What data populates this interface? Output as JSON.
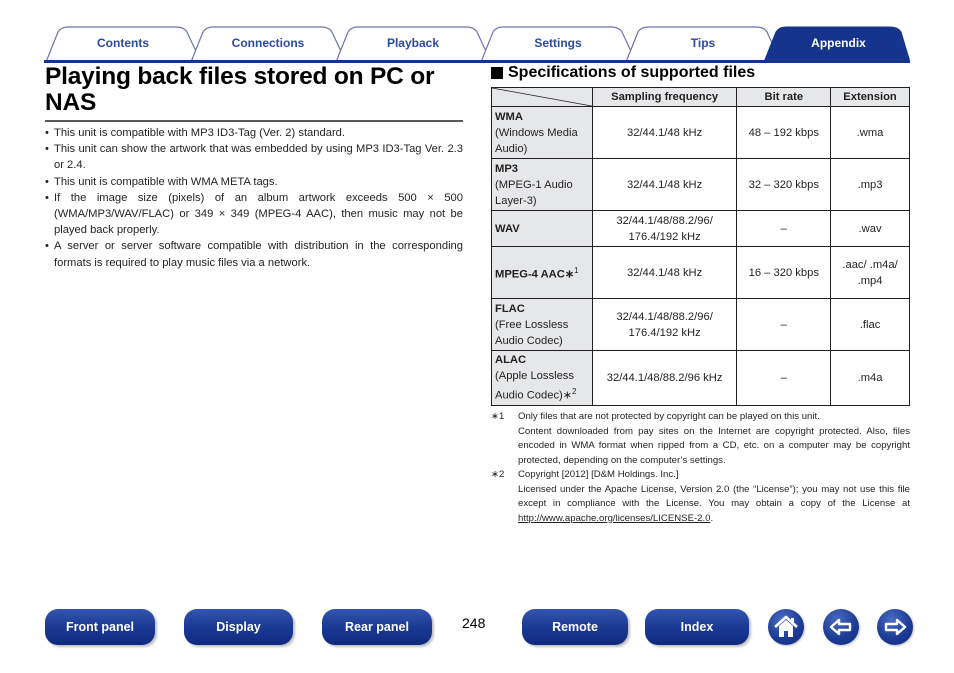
{
  "tabs": [
    {
      "label": "Contents",
      "active": false
    },
    {
      "label": "Connections",
      "active": false
    },
    {
      "label": "Playback",
      "active": false
    },
    {
      "label": "Settings",
      "active": false
    },
    {
      "label": "Tips",
      "active": false
    },
    {
      "label": "Appendix",
      "active": true
    }
  ],
  "colors": {
    "brand_blue": "#17348c",
    "tab_text": "#2b4aa0",
    "table_header_bg": "#e6e7e8"
  },
  "page": {
    "title": "Playing back files stored on PC or NAS",
    "bullets": [
      "This unit is compatible with MP3 ID3-Tag (Ver. 2) standard.",
      "This unit can show the artwork that was embedded by using MP3 ID3-Tag Ver. 2.3 or 2.4.",
      "This unit is compatible with WMA META tags.",
      "If the image size (pixels) of an album artwork exceeds 500 × 500 (WMA/MP3/WAV/FLAC) or 349 × 349 (MPEG-4 AAC), then music may not be played back properly.",
      "A server or server software compatible with distribution in the corresponding formats is required to play music files via a network."
    ]
  },
  "specs": {
    "heading": "Specifications of supported files",
    "columns": [
      "Sampling frequency",
      "Bit rate",
      "Extension"
    ],
    "rows": [
      {
        "name": "WMA",
        "desc": "(Windows Media Audio)",
        "note": "",
        "sampling": "32/44.1/48 kHz",
        "bitrate": "48 – 192 kbps",
        "extension": ".wma"
      },
      {
        "name": "MP3",
        "desc": "(MPEG-1 Audio Layer-3)",
        "note": "",
        "sampling": "32/44.1/48 kHz",
        "bitrate": "32 – 320 kbps",
        "extension": ".mp3"
      },
      {
        "name": "WAV",
        "desc": "",
        "note": "",
        "sampling": "32/44.1/48/88.2/96/ 176.4/192 kHz",
        "bitrate": "–",
        "extension": ".wav"
      },
      {
        "name": "MPEG-4 AAC",
        "desc": "",
        "note": "1",
        "sampling": "32/44.1/48 kHz",
        "bitrate": "16 – 320 kbps",
        "extension": ".aac/ .m4a/ .mp4"
      },
      {
        "name": "FLAC",
        "desc": "(Free Lossless Audio Codec)",
        "note": "",
        "sampling": "32/44.1/48/88.2/96/ 176.4/192 kHz",
        "bitrate": "–",
        "extension": ".flac"
      },
      {
        "name": "ALAC",
        "desc": "(Apple Lossless Audio Codec)",
        "note": "2",
        "sampling": "32/44.1/48/88.2/96 kHz",
        "bitrate": "–",
        "extension": ".m4a"
      }
    ],
    "footnotes": [
      {
        "mark": "1",
        "lines": [
          "Only files that are not protected by copyright can be played on this unit.",
          "Content downloaded from pay sites on the Internet are copyright protected. Also, files encoded in WMA format when ripped from a CD, etc. on a computer may be copyright protected, depending on the computer’s settings."
        ]
      },
      {
        "mark": "2",
        "lines": [
          "Copyright [2012] [D&M Holdings. Inc.]",
          "Licensed under the Apache License, Version 2.0 (the “License”); you may not use this file except in compliance with the License. You may obtain a copy of the License at"
        ],
        "link": "http://www.apache.org/licenses/LICENSE-2.0",
        "link_suffix": "."
      }
    ]
  },
  "bottom_nav": {
    "buttons": [
      "Front panel",
      "Display",
      "Rear panel",
      "Remote",
      "Index"
    ],
    "icons": [
      "home-icon",
      "arrow-left-icon",
      "arrow-right-icon"
    ],
    "page_number": "248"
  }
}
